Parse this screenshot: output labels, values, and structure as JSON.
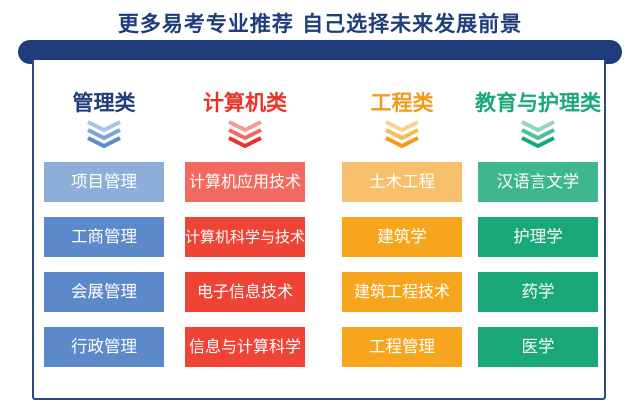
{
  "headline": "更多易考专业推荐 自己选择未来发展前景",
  "colors": {
    "navy": "#1f3d7a",
    "blue": "#5b89c9",
    "red": "#ef4335",
    "orange": "#f7a51c",
    "green": "#1aa87a"
  },
  "categories": [
    {
      "title": "管理类",
      "title_color": "#1f3d7a",
      "icon": "triple-chevron-down-icon",
      "items": [
        "项目管理",
        "工商管理",
        "会展管理",
        "行政管理"
      ]
    },
    {
      "title": "计算机类",
      "title_color": "#e8322a",
      "icon": "triple-chevron-down-icon",
      "items": [
        "计算机应用技术",
        "计算机科学与技术",
        "电子信息技术",
        "信息与计算科学"
      ]
    },
    {
      "title": "工程类",
      "title_color": "#f39a1a",
      "icon": "triple-chevron-down-icon",
      "items": [
        "土木工程",
        "建筑学",
        "建筑工程技术",
        "工程管理"
      ]
    },
    {
      "title": "教育与护理类",
      "title_color": "#1aa87a",
      "icon": "triple-chevron-down-icon",
      "items": [
        "汉语言文学",
        "护理学",
        "药学",
        "医学"
      ]
    }
  ]
}
